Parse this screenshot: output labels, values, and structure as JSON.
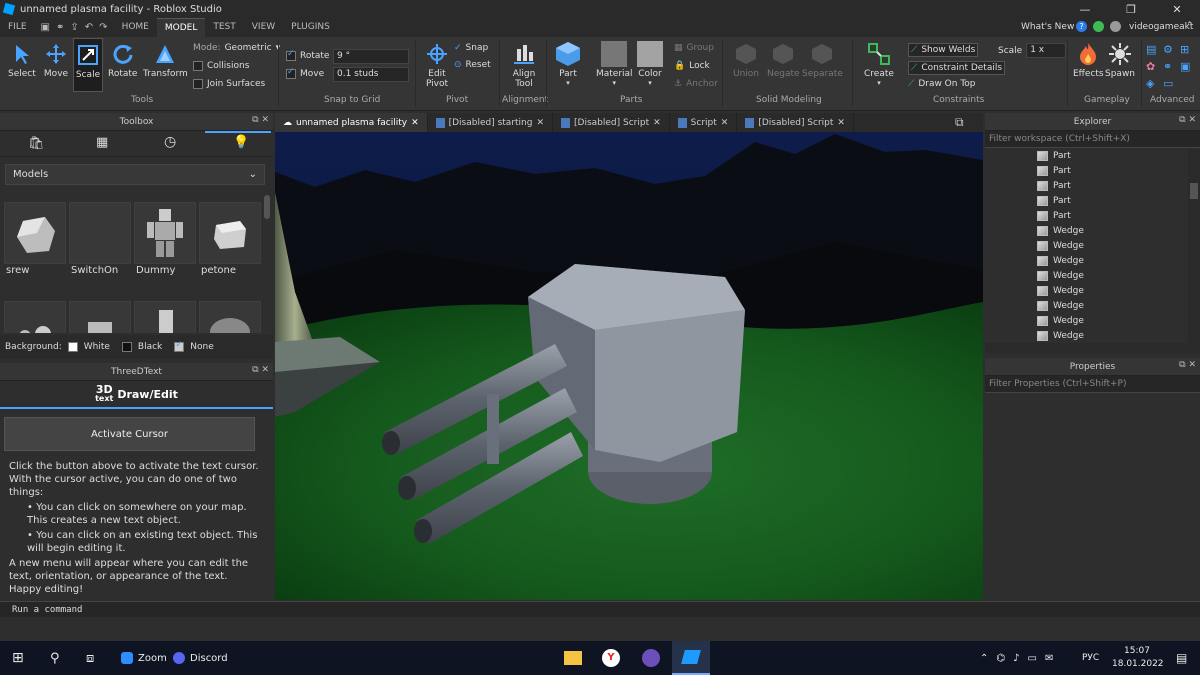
{
  "window": {
    "title": "unnamed plasma facility - Roblox Studio"
  },
  "menu": {
    "items": [
      "FILE",
      "HOME",
      "MODEL",
      "TEST",
      "VIEW",
      "PLUGINS"
    ],
    "active": "MODEL"
  },
  "top_right": {
    "whats_new": "What's New",
    "user": "videogameakt"
  },
  "ribbon": {
    "tools": {
      "select": "Select",
      "move": "Move",
      "scale": "Scale",
      "rotate": "Rotate",
      "transform": "Transform",
      "mode_label": "Mode:",
      "mode_value": "Geometric",
      "collisions": "Collisions",
      "join_surfaces": "Join Surfaces",
      "group": "Tools"
    },
    "snap": {
      "rotate": "Rotate",
      "rotate_value": "9 °",
      "move": "Move",
      "move_value": "0.1 studs",
      "group": "Snap to Grid"
    },
    "pivot": {
      "edit_pivot_1": "Edit",
      "edit_pivot_2": "Pivot",
      "snap": "Snap",
      "reset": "Reset",
      "group": "Pivot"
    },
    "alignment": {
      "align_1": "Align",
      "align_2": "Tool",
      "group": "Alignment"
    },
    "parts": {
      "part": "Part",
      "material": "Material",
      "color": "Color",
      "group_btn": "Group",
      "lock": "Lock",
      "anchor": "Anchor",
      "group": "Parts"
    },
    "solid": {
      "union": "Union",
      "negate": "Negate",
      "separate": "Separate",
      "group": "Solid Modeling"
    },
    "constraints": {
      "create": "Create",
      "show_welds": "Show Welds",
      "constraint_details": "Constraint Details",
      "draw_on_top": "Draw On Top",
      "scale_label": "Scale",
      "scale_value": "1 x",
      "group": "Constraints"
    },
    "gameplay": {
      "effects": "Effects",
      "spawn": "Spawn",
      "group": "Gameplay"
    },
    "advanced": {
      "group": "Advanced"
    }
  },
  "toolbox": {
    "title": "Toolbox",
    "category": "Models",
    "items": [
      "srew",
      "SwitchOn",
      "Dummy",
      "petone"
    ],
    "background_label": "Background:",
    "bg_options": [
      "White",
      "Black",
      "None"
    ]
  },
  "threedtext": {
    "title": "ThreeDText",
    "logo_top": "3D",
    "logo_bottom": "text",
    "tab": "Draw/Edit",
    "button": "Activate Cursor",
    "p1": "Click the button above to activate the text cursor. With the cursor active, you can do one of two things:",
    "b1": "• You can click on somewhere on your map. This creates a new text object.",
    "b2": "• You can click on an existing text object. This will begin editing it.",
    "p2": "A new menu will appear where you can edit the text, orientation, or appearance of the text. Happy editing!"
  },
  "doc_tabs": [
    "unnamed plasma facility",
    "[Disabled] starting",
    "[Disabled] Script",
    "Script",
    "[Disabled] Script"
  ],
  "explorer": {
    "title": "Explorer",
    "filter": "Filter workspace (Ctrl+Shift+X)",
    "rows": [
      "Part",
      "Part",
      "Part",
      "Part",
      "Part",
      "Wedge",
      "Wedge",
      "Wedge",
      "Wedge",
      "Wedge",
      "Wedge",
      "Wedge",
      "Wedge"
    ]
  },
  "properties": {
    "title": "Properties",
    "filter": "Filter Properties (Ctrl+Shift+P)"
  },
  "command_bar": {
    "placeholder": "Run a command"
  },
  "taskbar": {
    "zoom": "Zoom",
    "discord": "Discord",
    "lang": "РУС",
    "time": "15:07",
    "date": "18.01.2022"
  }
}
